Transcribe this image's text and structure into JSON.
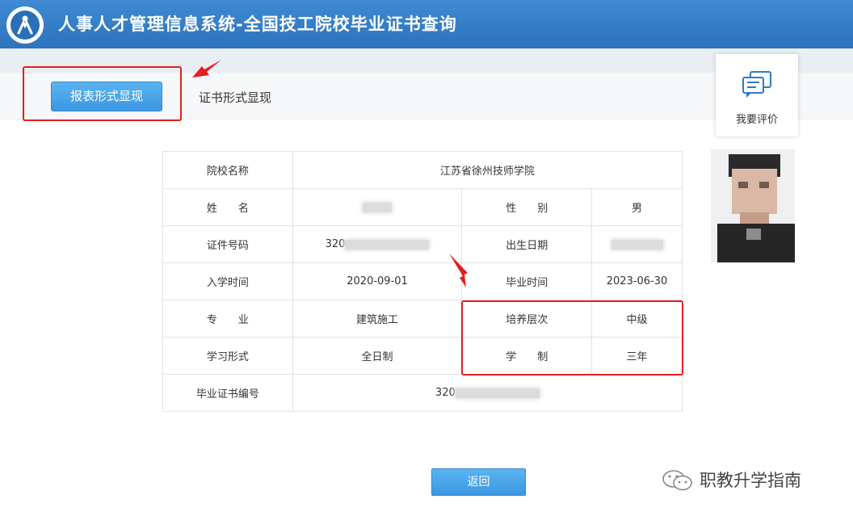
{
  "header": {
    "title": "人事人才管理信息系统-全国技工院校毕业证书查询",
    "logo_icon": "person-circle-logo-icon"
  },
  "tabs": {
    "report_label": "报表形式显现",
    "certificate_label": "证书形式显现"
  },
  "feedback": {
    "label": "我要评价",
    "icon": "comment-icon"
  },
  "record": {
    "school_label": "院校名称",
    "school_value": "江苏省徐州技师学院",
    "name_label": "姓　　名",
    "name_value": "",
    "gender_label": "性　　别",
    "gender_value": "男",
    "id_label": "证件号码",
    "id_value": "320",
    "birth_label": "出生日期",
    "birth_value": "",
    "enroll_label": "入学时间",
    "enroll_value": "2020-09-01",
    "graduate_label": "毕业时间",
    "graduate_value": "2023-06-30",
    "major_label": "专　　业",
    "major_value": "建筑施工",
    "level_label": "培养层次",
    "level_value": "中级",
    "mode_label": "学习形式",
    "mode_value": "全日制",
    "duration_label": "学　　制",
    "duration_value": "三年",
    "cert_label": "毕业证书编号",
    "cert_value": "320"
  },
  "actions": {
    "back_label": "返回"
  },
  "watermark": {
    "text": "职教升学指南"
  },
  "colors": {
    "header_blue": "#2c74bd",
    "button_blue": "#3c97e2",
    "highlight_red": "#e61d1d"
  }
}
